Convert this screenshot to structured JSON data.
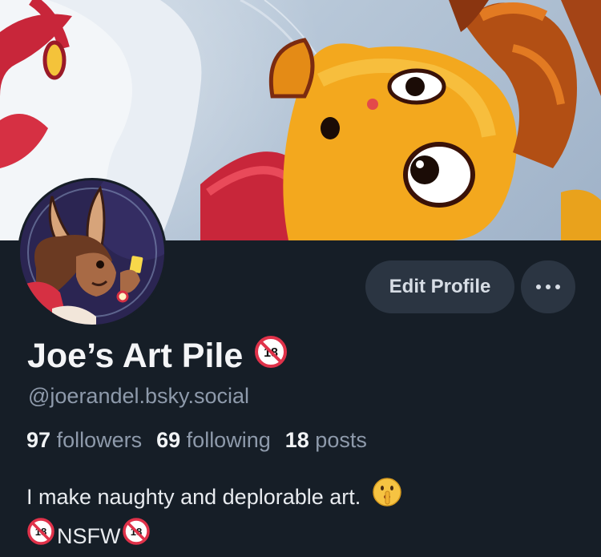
{
  "profile": {
    "display_name": "Joe’s Art Pile",
    "name_badge": "18",
    "handle": "@joerandel.bsky.social",
    "stats": [
      {
        "num": "97",
        "label": "followers"
      },
      {
        "num": "69",
        "label": "following"
      },
      {
        "num": "18",
        "label": "posts"
      }
    ],
    "bio_line1": "I make naughty and deplorable art.",
    "bio_tag": "NSFW",
    "badge_text": "18"
  },
  "actions": {
    "edit_label": "Edit Profile"
  },
  "icons": {
    "name_badge": "no-under-18-icon",
    "shh": "shushing-face-emoji",
    "more": "more-options-icon"
  },
  "colors": {
    "background": "#161e27",
    "button": "#2b3542",
    "muted_text": "#8e9aab",
    "badge_red": "#e0324a"
  }
}
